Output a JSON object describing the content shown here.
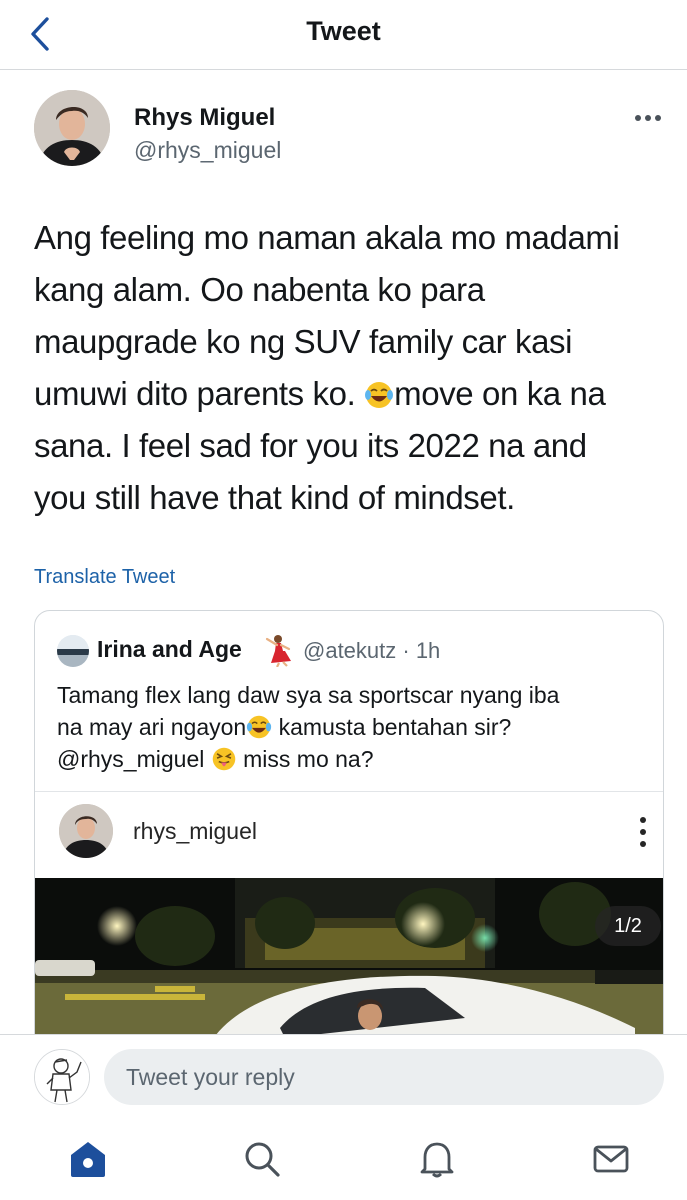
{
  "header": {
    "title": "Tweet",
    "back_icon": "chevron-left-icon"
  },
  "author": {
    "name": "Rhys Miguel",
    "handle": "@rhys_miguel",
    "more_icon": "more-horizontal-icon"
  },
  "tweet": {
    "lines": [
      "Ang feeling mo naman akala mo madami",
      "kang alam. Oo nabenta ko para",
      "maupgrade ko ng SUV family car kasi",
      "umuwi dito parents ko.",
      "move on ka na",
      "sana. I feel sad for you its 2022 na and",
      "you still have that kind of mindset."
    ],
    "emoji": "tears-of-joy-emoji",
    "translate_label": "Translate Tweet"
  },
  "quoted_tweet": {
    "name": "Irina and Age",
    "name_emoji": "dancer-emoji",
    "handle_time": "@atekutz · 1h",
    "lines": [
      "Tamang flex lang daw sya sa sportscar nyang iba",
      "na may ari ngayon",
      " kamusta bentahan sir?",
      "@rhys_miguel",
      " miss mo na?"
    ],
    "emojis": [
      "tears-of-joy-emoji",
      "squinting-tongue-emoji"
    ],
    "embed": {
      "username": "rhys_miguel",
      "photo_counter": "1/2",
      "more_icon": "more-vertical-icon"
    }
  },
  "reply": {
    "placeholder": "Tweet your reply"
  },
  "tabs": [
    {
      "name": "home",
      "icon": "home-icon"
    },
    {
      "name": "search",
      "icon": "search-icon"
    },
    {
      "name": "notifications",
      "icon": "bell-icon"
    },
    {
      "name": "messages",
      "icon": "mail-icon"
    }
  ],
  "colors": {
    "link": "#1d62a8",
    "accent": "#1d4f9c",
    "text": "#14171a",
    "muted": "#5b6670"
  }
}
